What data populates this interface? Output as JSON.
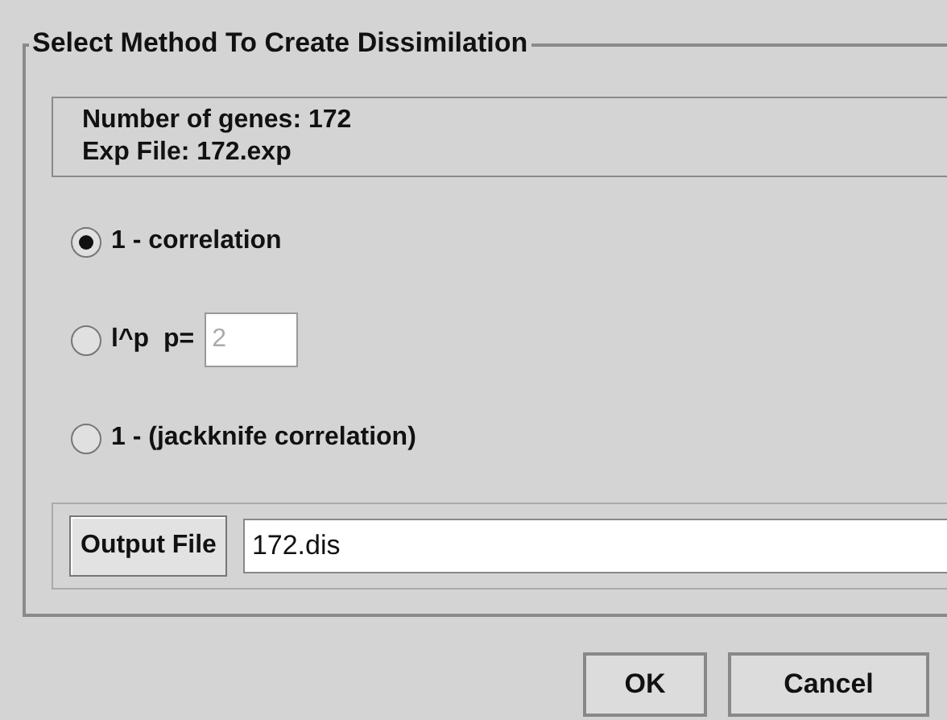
{
  "group": {
    "title": "Select Method To Create Dissimilation"
  },
  "info": [
    "Number of genes: 172",
    "Exp File: 172.exp"
  ],
  "methods": [
    {
      "label": "1 - correlation",
      "selected": true
    },
    {
      "label": "l^p  p=",
      "selected": false,
      "param": {
        "value": "2",
        "disabled": true
      }
    },
    {
      "label": "1 - (jackknife correlation)",
      "selected": false
    }
  ],
  "output": {
    "button": "Output File",
    "value": "172.dis"
  },
  "buttons": [
    "OK",
    "Cancel"
  ]
}
